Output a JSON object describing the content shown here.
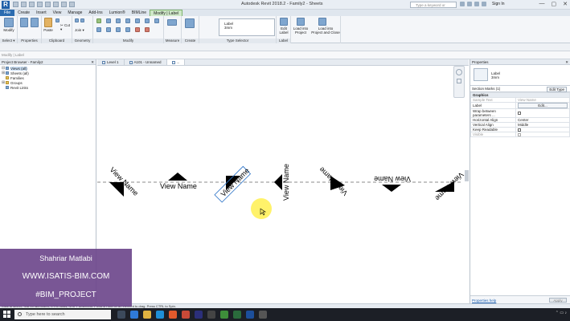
{
  "window": {
    "title": "Autodesk Revit 2018.2 - Family2 - Sheets",
    "search_placeholder": "Type a keyword or phrase",
    "sign_in": "Sign In",
    "controls": [
      "—",
      "▢",
      "✕"
    ]
  },
  "ribbon_tabs": [
    "File",
    "Create",
    "Insert",
    "View",
    "Manage",
    "Add-Ins",
    "Lumion®",
    "BIMLine",
    "Modify | Label"
  ],
  "active_tab": "Modify | Label",
  "ribbon": {
    "groups": [
      "Select ▾",
      "Properties",
      "Clipboard",
      "Geometry",
      "Modify",
      "Measure",
      "Create",
      "Type Selector",
      "Label",
      "Family Editor"
    ],
    "modify_btn": "Modify",
    "paste_btn": "Paste",
    "cut": "✂ Cut ▾",
    "join": "Join ▾",
    "type_box": [
      "Label",
      "3mm"
    ],
    "edit_label": [
      "Edit",
      "Label"
    ],
    "load_project": [
      "Load into",
      "Project"
    ],
    "load_close": [
      "Load into",
      "Project and Close"
    ]
  },
  "options_bar": "Modify | Label",
  "project_browser": {
    "title": "Project Browser - Family2",
    "items": [
      {
        "toggle": "⊟",
        "label": "Views (all)",
        "selected": true
      },
      {
        "toggle": "⊞",
        "label": "Sheets (all)"
      },
      {
        "toggle": "",
        "label": "Families"
      },
      {
        "toggle": "⊞",
        "label": "Groups"
      },
      {
        "toggle": "",
        "label": "Revit Links"
      }
    ]
  },
  "view_tabs": [
    {
      "label": "Level 1"
    },
    {
      "label": "A101 - Unnamed"
    },
    {
      "label": "..."
    }
  ],
  "canvas": {
    "labels": [
      "View Name",
      "View Name",
      "View Name",
      "View Name",
      "View Name",
      "View Name",
      "View Name"
    ]
  },
  "properties": {
    "title": "Properties",
    "type_name": [
      "Label",
      "3mm"
    ],
    "instance": "Section Marks (1)",
    "edit_type": "Edit Type",
    "category": "Graphics",
    "rows": [
      {
        "name": "Sample Text",
        "value": "View Name",
        "grey": true
      },
      {
        "name": "Label",
        "value": "Edit...",
        "button": true
      },
      {
        "name": "Wrap between parameters ...",
        "value": "",
        "checkbox": true
      },
      {
        "name": "Horizontal Align",
        "value": "Center"
      },
      {
        "name": "Vertical Align",
        "value": "Middle"
      },
      {
        "name": "Keep Readable",
        "value": "",
        "checkbox": true
      },
      {
        "name": "Visible",
        "value": "",
        "checkbox": true,
        "grey": true
      }
    ],
    "help": "Properties help",
    "apply": "Apply"
  },
  "status_bar": "Click to select, TAB for alternates, CTRL adds, SHIFT unselects. Press & Hold on an element to drag. Press CTRL to Spin.",
  "taskbar": {
    "search": "Type here to search"
  },
  "overlay": {
    "name": "Shahriar Matlabi",
    "site": "WWW.ISATIS-BIM.COM",
    "tag": "#BIM_PROJECT"
  },
  "colors": {
    "accent": "#2b6cb0",
    "active_tab": "#cfe8c8",
    "overlay": "#6e488c",
    "highlight": "#fff050"
  }
}
